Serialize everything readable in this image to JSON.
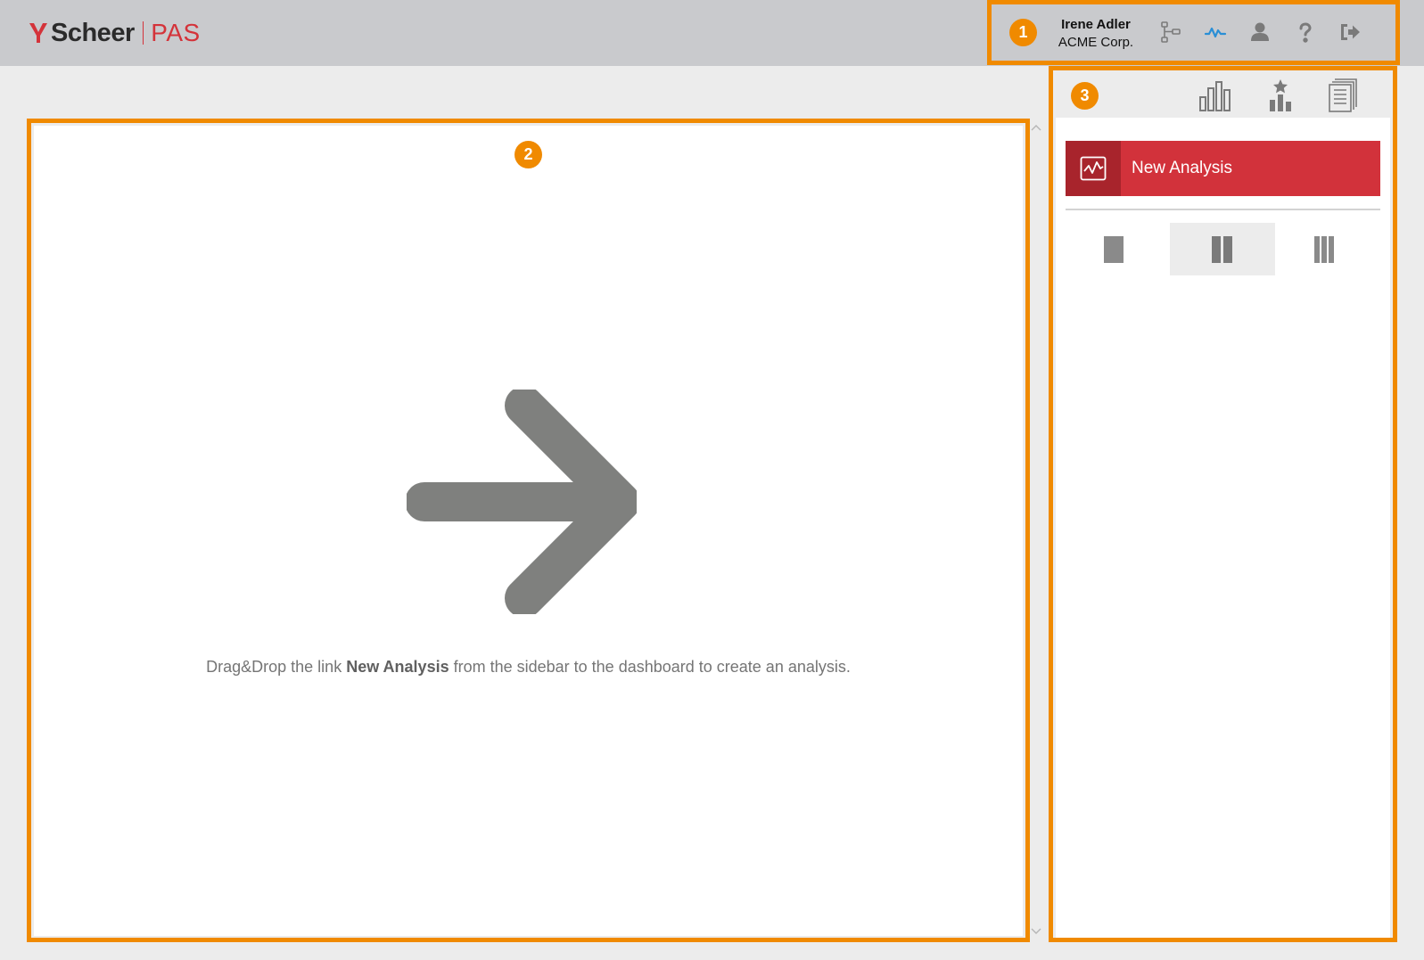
{
  "header": {
    "logo_brand": "Scheer",
    "logo_product": "PAS",
    "user_name": "Irene Adler",
    "user_company": "ACME Corp.",
    "icons": [
      "process-model-icon",
      "activity-icon",
      "user-icon",
      "help-icon",
      "logout-icon"
    ]
  },
  "annotations": {
    "badge1": "1",
    "badge2": "2",
    "badge3": "3"
  },
  "main": {
    "hint_prefix": "Drag&Drop the link ",
    "hint_strong": "New Analysis",
    "hint_suffix": " from the sidebar to the dashboard to create an analysis."
  },
  "sidebar": {
    "tabs": [
      "analysis-library-icon",
      "favorites-icon",
      "documents-icon"
    ],
    "new_analysis_label": "New Analysis",
    "layouts": [
      "one-column",
      "two-column",
      "three-column"
    ],
    "selected_layout": "two-column"
  },
  "colors": {
    "accent": "#f08a00",
    "brand_red": "#d2323b",
    "brand_red_dark": "#a8242c",
    "header_bg": "#c9cacd",
    "icon_gray": "#7a7a7a",
    "activity_blue": "#2a8fd6"
  }
}
